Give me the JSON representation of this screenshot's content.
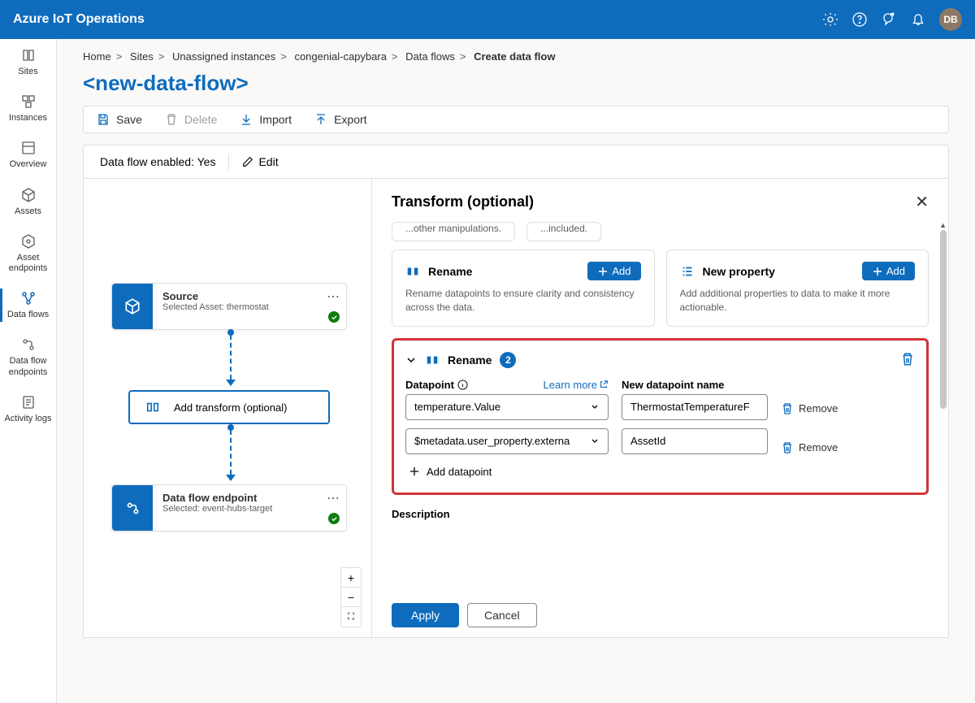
{
  "header": {
    "product": "Azure IoT Operations",
    "avatar_initials": "DB"
  },
  "sidebar": {
    "items": [
      {
        "label": "Sites",
        "icon": "book"
      },
      {
        "label": "Instances",
        "icon": "instances"
      },
      {
        "label": "Overview",
        "icon": "overview"
      },
      {
        "label": "Assets",
        "icon": "assets"
      },
      {
        "label": "Asset endpoints",
        "icon": "asset-endpoints"
      },
      {
        "label": "Data flows",
        "icon": "dataflows",
        "active": true
      },
      {
        "label": "Data flow endpoints",
        "icon": "df-endpoints"
      },
      {
        "label": "Activity logs",
        "icon": "activity"
      }
    ]
  },
  "breadcrumb": {
    "items": [
      "Home",
      "Sites",
      "Unassigned instances",
      "congenial-capybara",
      "Data flows"
    ],
    "current": "Create data flow"
  },
  "page": {
    "title": "<new-data-flow>"
  },
  "toolbar": {
    "save": "Save",
    "delete": "Delete",
    "import": "Import",
    "export": "Export"
  },
  "status": {
    "enabled_label": "Data flow enabled: Yes",
    "edit": "Edit"
  },
  "graph": {
    "source": {
      "title": "Source",
      "subtitle": "Selected Asset: thermostat"
    },
    "transform": {
      "title": "Add transform (optional)"
    },
    "endpoint": {
      "title": "Data flow endpoint",
      "subtitle": "Selected: event-hubs-target"
    }
  },
  "panel": {
    "title": "Transform (optional)",
    "truncated_left": "...other manipulations.",
    "truncated_right": "...included.",
    "rename_card": {
      "title": "Rename",
      "desc": "Rename datapoints to ensure clarity and consistency across the data.",
      "add": "Add"
    },
    "newprop_card": {
      "title": "New property",
      "desc": "Add additional properties to data to make it more actionable.",
      "add": "Add"
    },
    "section": {
      "title": "Rename",
      "count": "2",
      "datapoint_label": "Datapoint",
      "learn_more": "Learn more",
      "newname_label": "New datapoint name",
      "rows": [
        {
          "datapoint": "temperature.Value",
          "newname": "ThermostatTemperatureF"
        },
        {
          "datapoint": "$metadata.user_property.externa",
          "newname": "AssetId"
        }
      ],
      "remove": "Remove",
      "add_dp": "Add datapoint",
      "description_label": "Description"
    },
    "footer": {
      "apply": "Apply",
      "cancel": "Cancel"
    }
  }
}
